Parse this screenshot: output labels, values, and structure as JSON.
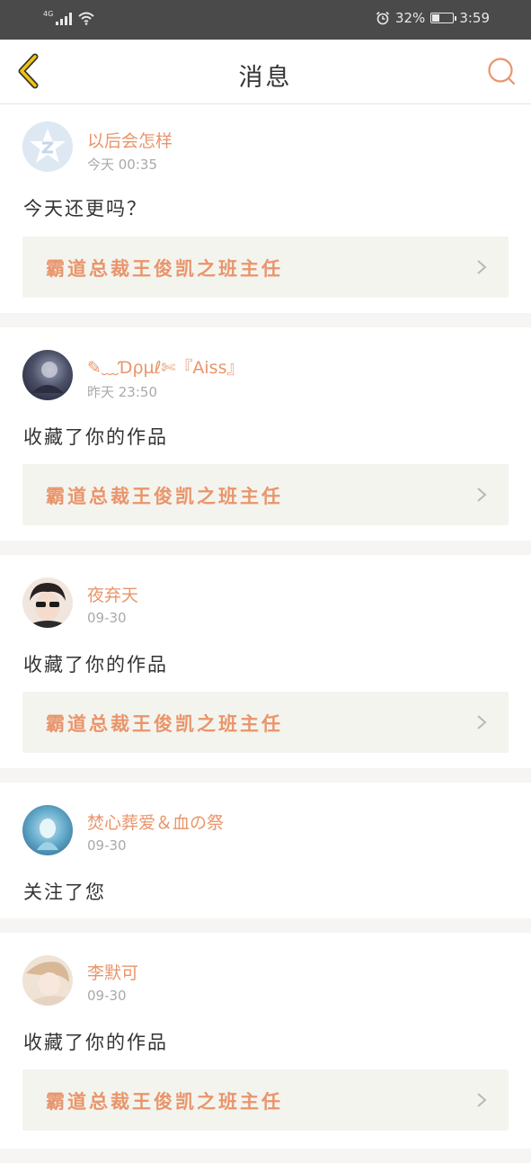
{
  "status_bar": {
    "network": "4G",
    "alarm_icon": "alarm-clock-icon",
    "battery_percent": "32%",
    "battery_level": 0.32,
    "time": "3:59"
  },
  "navbar": {
    "back_icon": "chevron-left-icon",
    "title": "消息",
    "search_icon": "search-icon"
  },
  "colors": {
    "accent": "#e9956b",
    "back_icon": "#f1c40f",
    "status_bar_bg": "#4a4a4a",
    "work_bg": "#f4f4ef"
  },
  "messages": [
    {
      "username": "以后会怎样",
      "time": "今天 00:35",
      "text": "今天还更吗？",
      "work_title": "霸道总裁王俊凯之班主任",
      "avatar_icon": "default-star-avatar-icon"
    },
    {
      "username": "✎﹏Ɗρµℓ✄『Aiss』",
      "time": "昨天 23:50",
      "text": "收藏了你的作品",
      "work_title": "霸道总裁王俊凯之班主任",
      "avatar_icon": "user-avatar"
    },
    {
      "username": "夜弃天",
      "time": "09-30",
      "text": "收藏了你的作品",
      "work_title": "霸道总裁王俊凯之班主任",
      "avatar_icon": "user-avatar"
    },
    {
      "username": "焚心葬爱＆血の祭",
      "time": "09-30",
      "text": "关注了您",
      "avatar_icon": "user-avatar"
    },
    {
      "username": "李默可",
      "time": "09-30",
      "text": "收藏了你的作品",
      "work_title": "霸道总裁王俊凯之班主任",
      "avatar_icon": "user-avatar"
    }
  ]
}
